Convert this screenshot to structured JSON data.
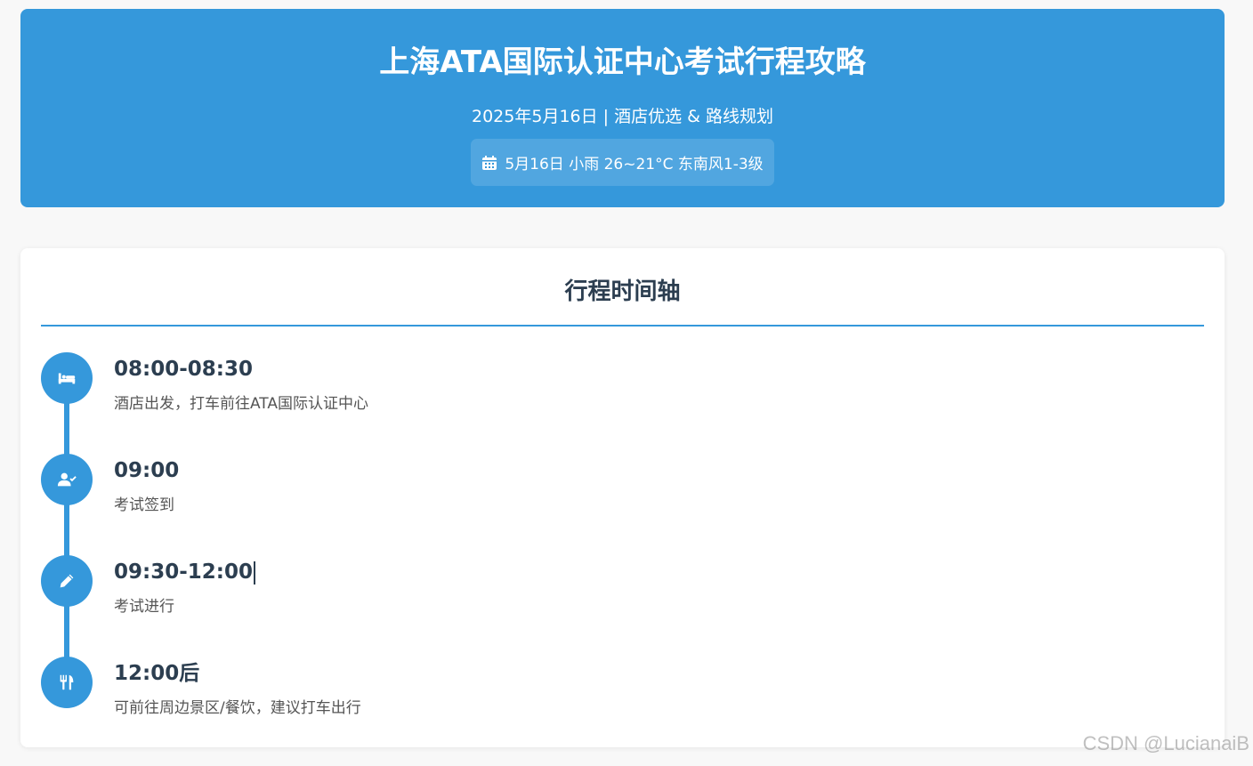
{
  "header": {
    "title": "上海ATA国际认证中心考试行程攻略",
    "subtitle": "2025年5月16日 | 酒店优选 & 路线规划",
    "weather": "5月16日 小雨 26~21°C 东南风1-3级"
  },
  "timeline": {
    "title": "行程时间轴",
    "items": [
      {
        "icon": "bed-icon",
        "time": "08:00-08:30",
        "desc": "酒店出发，打车前往ATA国际认证中心"
      },
      {
        "icon": "user-check-icon",
        "time": "09:00",
        "desc": "考试签到"
      },
      {
        "icon": "pencil-icon",
        "time": "09:30-12:00",
        "desc": "考试进行"
      },
      {
        "icon": "utensils-icon",
        "time": "12:00后",
        "desc": "可前往周边景区/餐饮，建议打车出行"
      }
    ]
  },
  "watermark": "CSDN @LucianaiB",
  "colors": {
    "accent": "#3598db",
    "text_dark": "#2c3e50",
    "background": "#f8f8f8"
  }
}
